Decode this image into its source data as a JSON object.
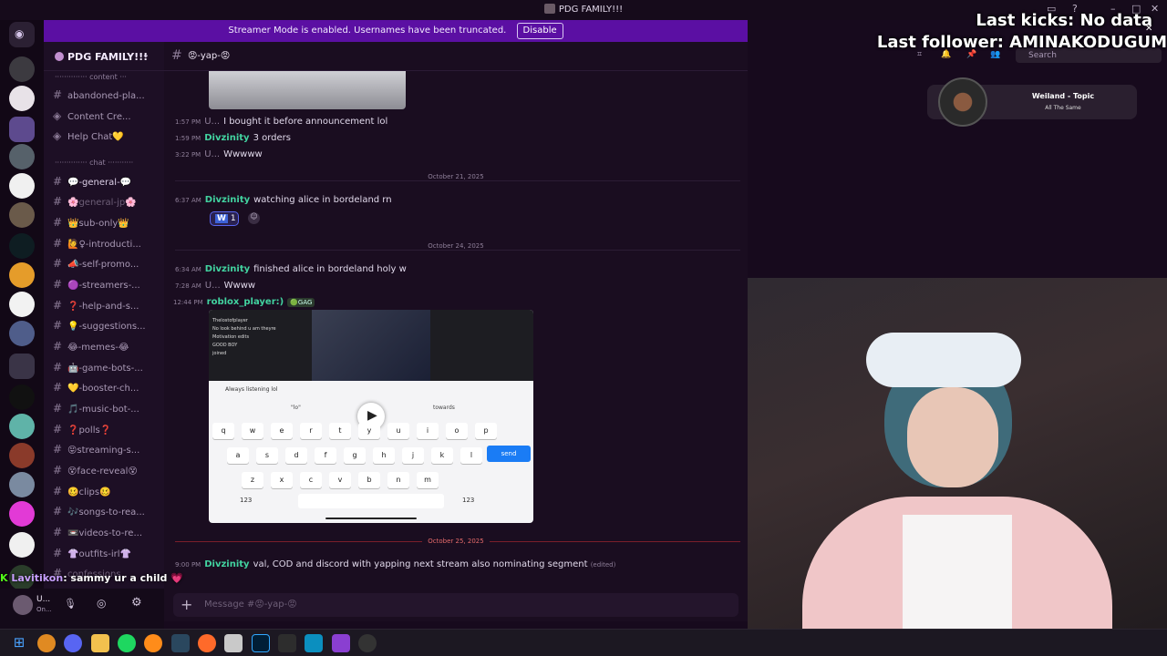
{
  "window": {
    "title": "PDG FAMILY!!!"
  },
  "banner": {
    "text": "Streamer Mode is enabled. Usernames have been truncated.",
    "button": "Disable"
  },
  "server": {
    "name": "PDG FAMILY!!!"
  },
  "channel": {
    "name": "😡-yap-😡"
  },
  "header": {
    "search_placeholder": "Search"
  },
  "sidebar": {
    "categories": [
      {
        "label": "·············· content ···"
      },
      {
        "label": "·············· chat ···········"
      }
    ],
    "channels": [
      {
        "label": "abandoned-pla..."
      },
      {
        "label": "Content Cre..."
      },
      {
        "label": "Help Chat💛"
      },
      {
        "label": "💬-general-💬"
      },
      {
        "label": "🌸general-jp🌸"
      },
      {
        "label": "👑sub-only👑"
      },
      {
        "label": "🙋♀-introducti..."
      },
      {
        "label": "📣-self-promo..."
      },
      {
        "label": "🟣-streamers-..."
      },
      {
        "label": "❓-help-and-s..."
      },
      {
        "label": "💡-suggestions..."
      },
      {
        "label": "😂-memes-😂"
      },
      {
        "label": "🤖-game-bots-..."
      },
      {
        "label": "💛-booster-ch..."
      },
      {
        "label": "🎵-music-bot-..."
      },
      {
        "label": "❓polls❓"
      },
      {
        "label": "😝streaming-s..."
      },
      {
        "label": "😵face-reveal😵"
      },
      {
        "label": "🥴clips🥴"
      },
      {
        "label": "🎶songs-to-rea..."
      },
      {
        "label": "📼videos-to-re..."
      },
      {
        "label": "👚outfits-irl👚"
      },
      {
        "label": "confessions"
      }
    ]
  },
  "messages": [
    {
      "time": "1:57 PM",
      "user": "U...",
      "text": "I bought it before announcement lol"
    },
    {
      "time": "1:59 PM",
      "user": "Divzinity",
      "text": "3 orders"
    },
    {
      "time": "3:22 PM",
      "user": "U...",
      "text": "Wwwww"
    },
    {
      "date": "October 21, 2025"
    },
    {
      "time": "6:37 AM",
      "user": "Divzinity",
      "text": "watching alice in bordeland rn"
    },
    {
      "date": "October 24, 2025"
    },
    {
      "time": "6:34 AM",
      "user": "Divzinity",
      "text": "finished alice in bordeland holy w"
    },
    {
      "time": "7:28 AM",
      "user": "U...",
      "text": "Wwww"
    },
    {
      "time": "12:44 PM",
      "user": "roblox_player:)",
      "tag": "🟢GAG"
    },
    {
      "date": "October 25, 2025"
    },
    {
      "time": "9:00 PM",
      "user": "Divzinity",
      "text": "val, COD and discord with yapping next stream also nominating segment",
      "edited": "(edited)"
    }
  ],
  "reaction": {
    "emoji": "W",
    "count": "1"
  },
  "embed": {
    "chat_lines": [
      "Thelostofplayer",
      "No look behind u am theyre",
      "Motivation edits",
      "GOOD BOY",
      "joined"
    ],
    "input_text": "Always listening lol",
    "suggestions": [
      "\"lo\"",
      "towards"
    ],
    "keys_row1": [
      "q",
      "w",
      "e",
      "r",
      "t",
      "y",
      "u",
      "i",
      "o",
      "p"
    ],
    "keys_row2": [
      "a",
      "s",
      "d",
      "f",
      "g",
      "h",
      "j",
      "k",
      "l"
    ],
    "keys_row3": [
      "z",
      "x",
      "c",
      "v",
      "b",
      "n",
      "m"
    ],
    "send": "send",
    "num": "123"
  },
  "composer": {
    "placeholder": "Message #😡-yap-😡"
  },
  "user_panel": {
    "name": "U...",
    "status": "On..."
  },
  "now_playing": {
    "title": "Weiland - Topic",
    "subtitle": "All The Same"
  },
  "overlay": {
    "kicks": "Last kicks: No data",
    "follower": "Last follower: AMINAKODUGUM"
  },
  "stream_alert": {
    "user": "Lavitikon",
    "text": ": sammy ur a child 💗"
  }
}
